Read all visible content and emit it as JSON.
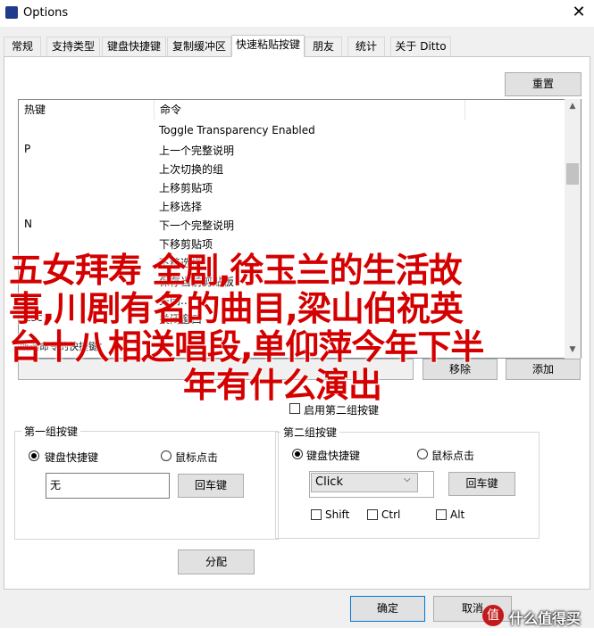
{
  "window": {
    "title": "Options"
  },
  "tabs": [
    "常规",
    "支持类型",
    "键盘快捷键",
    "复制缓冲区",
    "快速粘贴按键",
    "朋友",
    "统计",
    "关于 Ditto"
  ],
  "reset_label": "重置",
  "list": {
    "columns": [
      "热键",
      "命令"
    ],
    "rows": [
      {
        "key": "",
        "cmd": "Toggle Transparency Enabled"
      },
      {
        "key": "P",
        "cmd": "上一个完整说明"
      },
      {
        "key": "",
        "cmd": "上次切换的组"
      },
      {
        "key": "",
        "cmd": "上移剪贴项"
      },
      {
        "key": "",
        "cmd": "上移选择"
      },
      {
        "key": "N",
        "cmd": "下一个完整说明"
      },
      {
        "key": "",
        "cmd": "下移剪贴项"
      },
      {
        "key": "",
        "cmd": "下移选择"
      },
      {
        "key": "",
        "cmd": "保存当前剪贴板"
      },
      {
        "key": "",
        "cmd": "关闭..."
      },
      {
        "key": "Esc",
        "cmd": "关闭窗口"
      }
    ]
  },
  "command_label": "所选命令的快捷键：",
  "remove_label": "移除",
  "add_label": "添加",
  "use_second_label": "启用第二组按键",
  "group1": {
    "title": "第一组按键",
    "radio_keyboard": "键盘快捷键",
    "radio_mouse": "鼠标点击",
    "input_value": "无",
    "enter_label": "回车键"
  },
  "group2": {
    "title": "第二组按键",
    "radio_keyboard": "键盘快捷键",
    "radio_mouse": "鼠标点击",
    "select_value": "Click",
    "enter_label": "回车键",
    "shift": "Shift",
    "ctrl": "Ctrl",
    "alt": "Alt"
  },
  "assign_label": "分配",
  "ok_label": "确定",
  "cancel_label": "取消",
  "overlay": {
    "line1": "五女拜寿 全剧,徐玉兰的生活故",
    "line2": "事,川剧有名的曲目,梁山伯祝英",
    "line3": "台十八相送唱段,单仰萍今年下半",
    "line4": "年有什么演出"
  },
  "watermark": {
    "icon": "值",
    "text": "什么值得买"
  }
}
